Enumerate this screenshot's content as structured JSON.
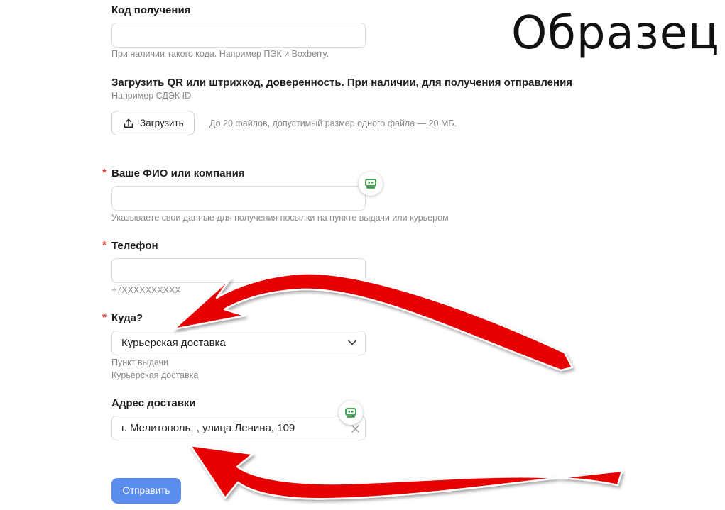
{
  "watermark": "Образец",
  "pickup_code": {
    "label": "Код получения",
    "value": "",
    "hint": "При наличии такого кода. Например ПЭК и Boxberry."
  },
  "upload": {
    "label": "Загрузить QR или штрихкод, доверенность. При наличии, для получения отправления",
    "sub_hint": "Например СДЭК ID",
    "button_label": "Загрузить",
    "limit_hint": "До 20 файлов, допустимый размер одного файла — 20 МБ."
  },
  "name_field": {
    "required_mark": "*",
    "label": "Ваше ФИО или компания",
    "value": "",
    "hint": "Указываете свои данные для получения посылки на пункте выдачи или курьером"
  },
  "phone_field": {
    "required_mark": "*",
    "label": "Телефон",
    "value": "",
    "hint": "+7XXXXXXXXXX"
  },
  "destination": {
    "required_mark": "*",
    "label": "Куда?",
    "selected": "Курьерская доставка",
    "options": [
      "Пункт выдачи",
      "Курьерская доставка"
    ]
  },
  "address": {
    "label": "Адрес доставки",
    "value": "г. Мелитополь, , улица Ленина, 109"
  },
  "submit_label": "Отправить",
  "colors": {
    "accent": "#5b8def",
    "required": "#e53935",
    "arrow": "#e60000",
    "badge_icon": "#2e9e3e"
  },
  "icons": [
    "upload-icon",
    "chevron-down-icon",
    "clear-icon",
    "autofill-badge-icon"
  ]
}
